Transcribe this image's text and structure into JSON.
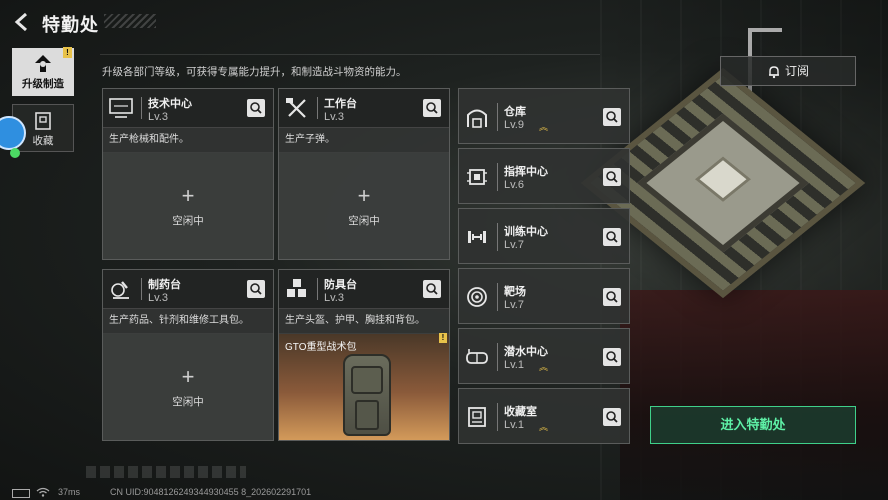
{
  "header": {
    "title": "特勤处",
    "description": "升级各部门等级，可获得专属能力提升，和制造战斗物资的能力。"
  },
  "sidebar": {
    "tabs": [
      {
        "label": "升级制造",
        "icon": "upgrade-craft-icon",
        "active": true,
        "badge": "!"
      },
      {
        "label": "收藏",
        "icon": "collection-icon",
        "active": false
      }
    ]
  },
  "workshops": [
    {
      "name": "技术中心",
      "level": "Lv.3",
      "icon": "monitor-icon",
      "desc": "生产枪械和配件。",
      "slot": {
        "plus": "+",
        "status": "空闲中"
      }
    },
    {
      "name": "工作台",
      "level": "Lv.3",
      "icon": "tools-icon",
      "desc": "生产子弹。",
      "slot": {
        "plus": "+",
        "status": "空闲中"
      }
    },
    {
      "name": "制药台",
      "level": "Lv.3",
      "icon": "microscope-icon",
      "desc": "生产药品、针剂和维修工具包。",
      "slot": {
        "plus": "+",
        "status": "空闲中"
      }
    },
    {
      "name": "防具台",
      "level": "Lv.3",
      "icon": "armor-cubes-icon",
      "desc": "生产头盔、护甲、胸挂和背包。",
      "slot": {
        "item": "GTO重型战术包",
        "badge": "!"
      }
    }
  ],
  "facilities": [
    {
      "name": "仓库",
      "level": "Lv.9",
      "icon": "warehouse-icon",
      "upgradable": true
    },
    {
      "name": "指挥中心",
      "level": "Lv.6",
      "icon": "chip-icon",
      "upgradable": false
    },
    {
      "name": "训练中心",
      "level": "Lv.7",
      "icon": "dumbbell-icon",
      "upgradable": false
    },
    {
      "name": "靶场",
      "level": "Lv.7",
      "icon": "target-icon",
      "upgradable": false
    },
    {
      "name": "潜水中心",
      "level": "Lv.1",
      "icon": "diving-mask-icon",
      "upgradable": true
    },
    {
      "name": "收藏室",
      "level": "Lv.1",
      "icon": "collection-room-icon",
      "upgradable": true
    }
  ],
  "controls": {
    "subscribe_label": "订阅",
    "enter_label": "进入特勤处"
  },
  "status_bar": {
    "ping": "37ms",
    "uid": "CN UID:9048126249344930455 8_202602291701"
  },
  "colors": {
    "accent_green": "#5ef0a6",
    "badge_yellow": "#e8c24a"
  }
}
